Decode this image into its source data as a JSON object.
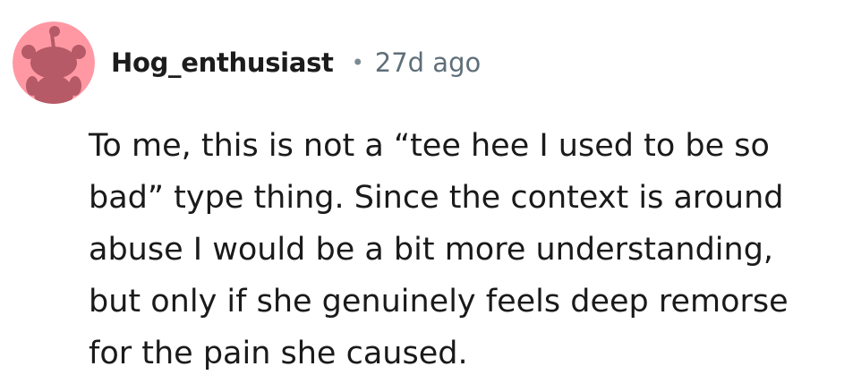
{
  "comment": {
    "author": "Hog_enthusiast",
    "separator": "•",
    "age": "27d ago",
    "body_lines": [
      "To me, this is not a “tee hee I used to be so",
      "bad” type thing. Since the context is around",
      "abuse I would be a bit more understanding,",
      "but only if she genuinely feels deep remorse",
      "for the pain she caused."
    ]
  },
  "avatar": {
    "icon": "snoo-avatar-icon",
    "background_color": "#ff98a3",
    "figure_color": "#b55a66"
  }
}
